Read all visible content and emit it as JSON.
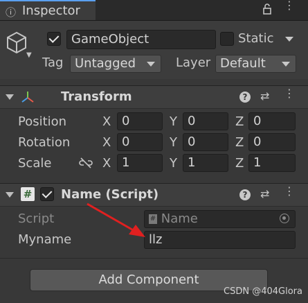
{
  "tab": {
    "title": "Inspector",
    "icon": "info-icon"
  },
  "gameobject": {
    "name": "GameObject",
    "active": true,
    "static_label": "Static",
    "tag_label": "Tag",
    "tag_value": "Untagged",
    "layer_label": "Layer",
    "layer_value": "Default"
  },
  "transform": {
    "title": "Transform",
    "rows": [
      {
        "label": "Position",
        "x": "0",
        "y": "0",
        "z": "0"
      },
      {
        "label": "Rotation",
        "x": "0",
        "y": "0",
        "z": "0"
      },
      {
        "label": "Scale",
        "x": "1",
        "y": "1",
        "z": "1"
      }
    ],
    "axis": {
      "x": "X",
      "y": "Y",
      "z": "Z"
    }
  },
  "script": {
    "title": "Name (Script)",
    "enabled": true,
    "script_label": "Script",
    "script_value": "Name",
    "field_label": "Myname",
    "field_value": "llz"
  },
  "add_component": "Add Component",
  "watermark": "CSDN @404Glora",
  "colors": {
    "background": "#383838",
    "field": "#2a2a2a",
    "accent_tab": "#5aa0f0",
    "annotation_arrow": "#e02020"
  }
}
